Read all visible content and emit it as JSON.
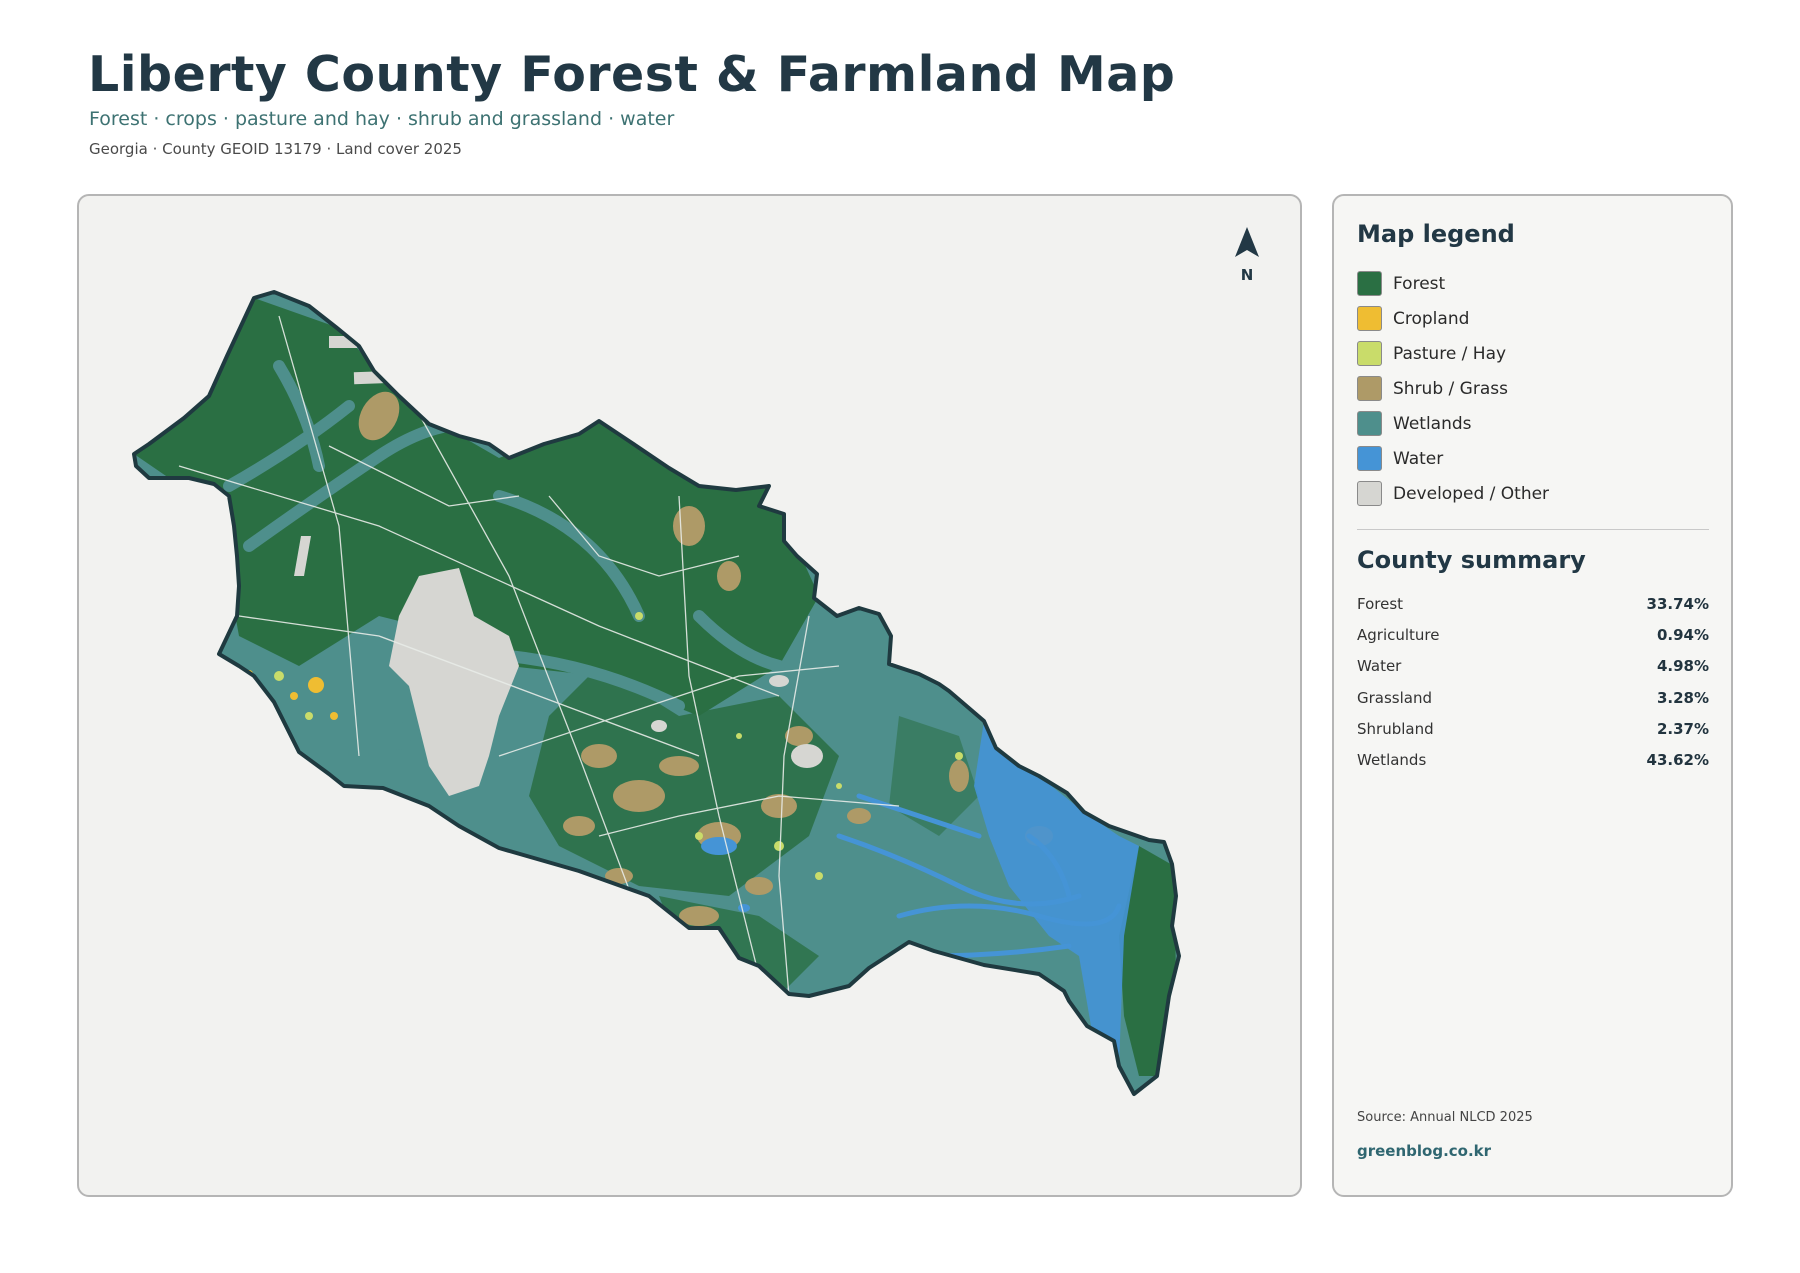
{
  "header": {
    "title": "Liberty County Forest & Farmland Map",
    "subtitle": "Forest · crops · pasture and hay · shrub and grassland · water",
    "meta": "Georgia · County GEOID 13179 · Land cover 2025"
  },
  "map": {
    "north_label": "N"
  },
  "legend": {
    "title": "Map legend",
    "items": [
      {
        "label": "Forest",
        "color": "#2a6f43"
      },
      {
        "label": "Cropland",
        "color": "#efbd32"
      },
      {
        "label": "Pasture / Hay",
        "color": "#c9dc6a"
      },
      {
        "label": "Shrub / Grass",
        "color": "#ae9a67"
      },
      {
        "label": "Wetlands",
        "color": "#4e8f8c"
      },
      {
        "label": "Water",
        "color": "#4594d6"
      },
      {
        "label": "Developed / Other",
        "color": "#d6d6d2"
      }
    ]
  },
  "summary": {
    "title": "County summary",
    "rows": [
      {
        "label": "Forest",
        "value": "33.74%"
      },
      {
        "label": "Agriculture",
        "value": "0.94%"
      },
      {
        "label": "Water",
        "value": "4.98%"
      },
      {
        "label": "Grassland",
        "value": "3.28%"
      },
      {
        "label": "Shrubland",
        "value": "2.37%"
      },
      {
        "label": "Wetlands",
        "value": "43.62%"
      }
    ]
  },
  "footer": {
    "source": "Source: Annual NLCD 2025",
    "credit": "greenblog.co.kr"
  }
}
